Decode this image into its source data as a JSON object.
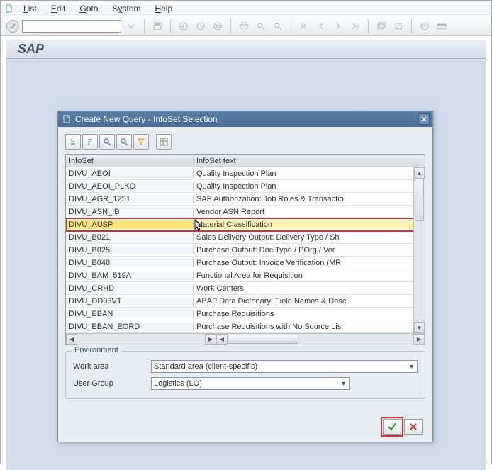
{
  "menu": {
    "list": "List",
    "edit": "Edit",
    "goto": "Goto",
    "system": "System",
    "help": "Help"
  },
  "app_title": "SAP",
  "dialog": {
    "title": "Create New Query - InfoSet Selection",
    "columns": {
      "c1": "InfoSet",
      "c2": "InfoSet text"
    },
    "rows": [
      {
        "id": "DIVU_AEOI",
        "text": "Quality Inspection Plan"
      },
      {
        "id": "DIVU_AEOI_PLKO",
        "text": "Quality Inspection Plan"
      },
      {
        "id": "DIVU_AGR_1251",
        "text": "SAP Authorization: Job Roles & Transactio"
      },
      {
        "id": "DIVU_ASN_IB",
        "text": "Vendor ASN Report"
      },
      {
        "id": "DIVU_AUSP",
        "text": "Material Classification",
        "selected": true
      },
      {
        "id": "DIVU_B021",
        "text": "Sales Delivery Output: Delivery Type / Sh"
      },
      {
        "id": "DIVU_B025",
        "text": "Purchase Output: Doc Type / POrg / Ver"
      },
      {
        "id": "DIVU_B048",
        "text": "Purchase Output: Invoice Verification (MR"
      },
      {
        "id": "DIVU_BAM_519A",
        "text": "Functional Area for Requisition"
      },
      {
        "id": "DIVU_CRHD",
        "text": "Work Centers"
      },
      {
        "id": "DIVU_DD03VT",
        "text": "ABAP Data Dictonary: Field Names & Desc"
      },
      {
        "id": "DIVU_EBAN",
        "text": "Purchase Requisitions"
      },
      {
        "id": "DIVU_EBAN_EORD",
        "text": "Purchase Requisitions with No Source Lis"
      }
    ],
    "env": {
      "legend": "Environment",
      "work_area_label": "Work area",
      "work_area_value": "Standard area (client-specific)",
      "user_group_label": "User Group",
      "user_group_value": "Logistics    (LO)"
    }
  }
}
